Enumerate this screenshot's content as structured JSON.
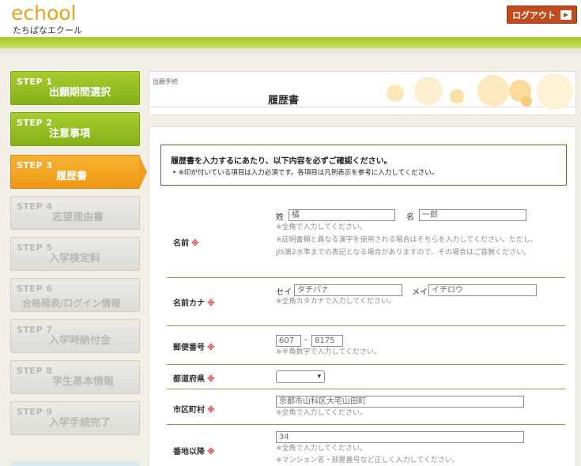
{
  "header": {
    "logo_main": "echool",
    "logo_sub": "たちばなエクール",
    "logout_label": "ログアウト"
  },
  "steps": [
    {
      "num": "STEP 1",
      "label": "出願期間選択",
      "state": "done"
    },
    {
      "num": "STEP 2",
      "label": "注意事項",
      "state": "done"
    },
    {
      "num": "STEP 3",
      "label": "履歴書",
      "state": "current"
    },
    {
      "num": "STEP 4",
      "label": "志望理由書",
      "state": "todo"
    },
    {
      "num": "STEP 5",
      "label": "入学検定料",
      "state": "todo"
    },
    {
      "num": "STEP 6",
      "label": "合格発表/ログイン情報",
      "state": "todo"
    },
    {
      "num": "STEP 7",
      "label": "入学時納付金",
      "state": "todo"
    },
    {
      "num": "STEP 8",
      "label": "学生基本情報",
      "state": "todo"
    },
    {
      "num": "STEP 9",
      "label": "入学手続完了",
      "state": "todo"
    }
  ],
  "title": {
    "crumb": "出願手続",
    "page_title": "履歴書"
  },
  "notice": {
    "head": "履歴書を入力するにあたり、以下内容を必ずご確認ください。",
    "item": "• ※印が付いている項目は入力必須です。各項目は凡例表示を参考に入力してください。"
  },
  "form": {
    "required_mark": "※",
    "name": {
      "label": "名前",
      "sei_label": "姓",
      "sei_value": "橘",
      "mei_label": "名",
      "mei_value": "一郎",
      "hint1": "※全角で入力してください。",
      "hint2": "※証明書類と異なる漢字を使用される場合はそちらを入力してください。ただし、",
      "hint3": "JIS第2水準までの表記となる場合がありますので、その場合はご容赦ください。"
    },
    "kana": {
      "label": "名前カナ",
      "sei_label": "セイ",
      "sei_value": "タチバナ",
      "mei_label": "メイ",
      "mei_value": "イチロウ",
      "hint": "※全角カタカナで入力してください。"
    },
    "zip": {
      "label": "郵便番号",
      "part1": "607",
      "sep": "-",
      "part2": "8175",
      "hint": "※半角数字で入力してください。"
    },
    "pref": {
      "label": "都道府県",
      "value": ""
    },
    "city": {
      "label": "市区町村",
      "value": "京都市山科区大宅山田町",
      "hint": "※全角で入力してください。"
    },
    "address": {
      "label": "番地以降",
      "value": "34",
      "hint1": "※全角で入力してください。",
      "hint2": "※マンション名・部屋番号など正しく入力してください。"
    }
  }
}
